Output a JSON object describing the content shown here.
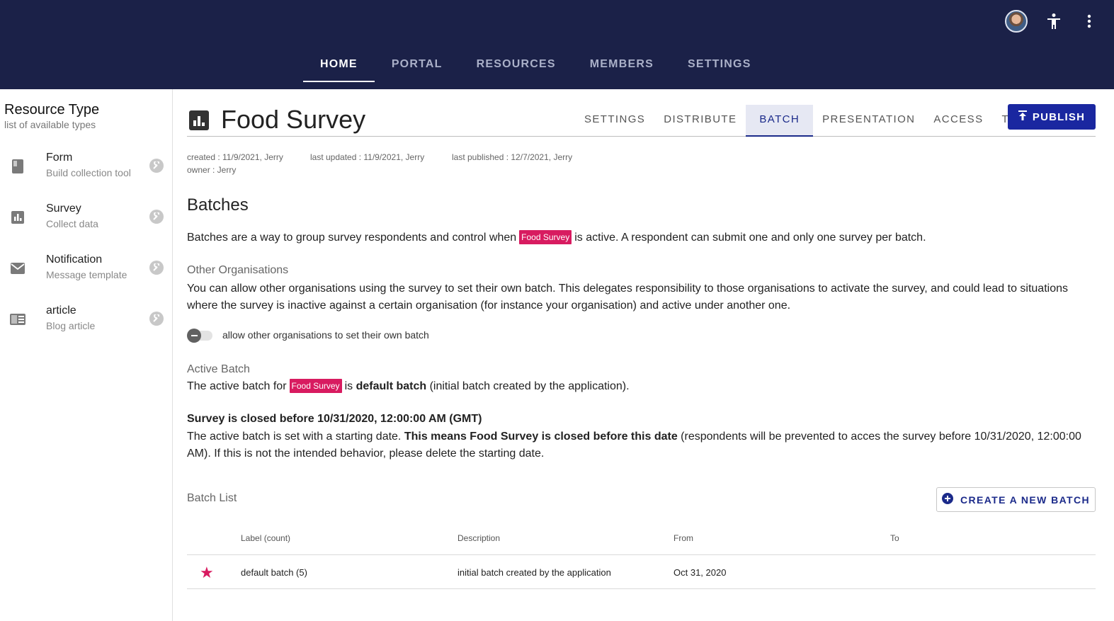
{
  "nav": {
    "tabs": [
      {
        "label": "HOME"
      },
      {
        "label": "PORTAL"
      },
      {
        "label": "RESOURCES"
      },
      {
        "label": "MEMBERS"
      },
      {
        "label": "SETTINGS"
      }
    ],
    "active": "HOME"
  },
  "sidebar": {
    "title": "Resource Type",
    "subtitle": "list of available types",
    "items": [
      {
        "name": "Form",
        "desc": "Build collection tool",
        "icon": "book-icon"
      },
      {
        "name": "Survey",
        "desc": "Collect data",
        "icon": "chart-icon"
      },
      {
        "name": "Notification",
        "desc": "Message template",
        "icon": "mail-icon"
      },
      {
        "name": "article",
        "desc": "Blog article",
        "icon": "article-icon"
      }
    ]
  },
  "page": {
    "title": "Food Survey",
    "subtabs": [
      "SETTINGS",
      "DISTRIBUTE",
      "BATCH",
      "PRESENTATION",
      "ACCESS",
      "TERMS"
    ],
    "active_subtab": "BATCH",
    "publish_label": "PUBLISH",
    "meta": {
      "created": "created : 11/9/2021, Jerry",
      "updated": "last updated : 11/9/2021, Jerry",
      "published": "last published : 12/7/2021, Jerry",
      "owner": "owner : Jerry"
    }
  },
  "batches": {
    "heading": "Batches",
    "intro_before": "Batches are a way to group survey respondents and control when",
    "chip": "Food Survey",
    "intro_after": "is active. A respondent can submit one and only one survey per batch.",
    "other_orgs_label": "Other Organisations",
    "other_orgs_text": "You can allow other organisations using the survey to set their own batch. This delegates responsibility to those organisations to activate the survey, and could lead to situations where the survey is inactive against a certain organisation (for instance your organisation) and active under another one.",
    "toggle_label": "allow other organisations to set their own batch",
    "active_label": "Active Batch",
    "active_before": "The active batch for",
    "active_mid": "is",
    "active_bold": "default batch",
    "active_after": "(initial batch created by the application).",
    "closed_heading": "Survey is closed before 10/31/2020, 12:00:00 AM (GMT)",
    "closed_before": "The active batch is set with a starting date.",
    "closed_bold": "This means Food Survey is closed before this date",
    "closed_after": "(respondents will be prevented to acces the survey before 10/31/2020, 12:00:00 AM). If this is not the intended behavior, please delete the starting date.",
    "list_label": "Batch List",
    "create_label": "CREATE A NEW BATCH"
  },
  "table": {
    "headers": [
      "Label (count)",
      "Description",
      "From",
      "To"
    ],
    "rows": [
      {
        "label": "default batch (5)",
        "description": "initial batch created by the application",
        "from": "Oct 31, 2020",
        "to": ""
      }
    ]
  },
  "colors": {
    "topbar": "#1b2148",
    "accent": "#1a27a0",
    "chip": "#d81b60"
  }
}
